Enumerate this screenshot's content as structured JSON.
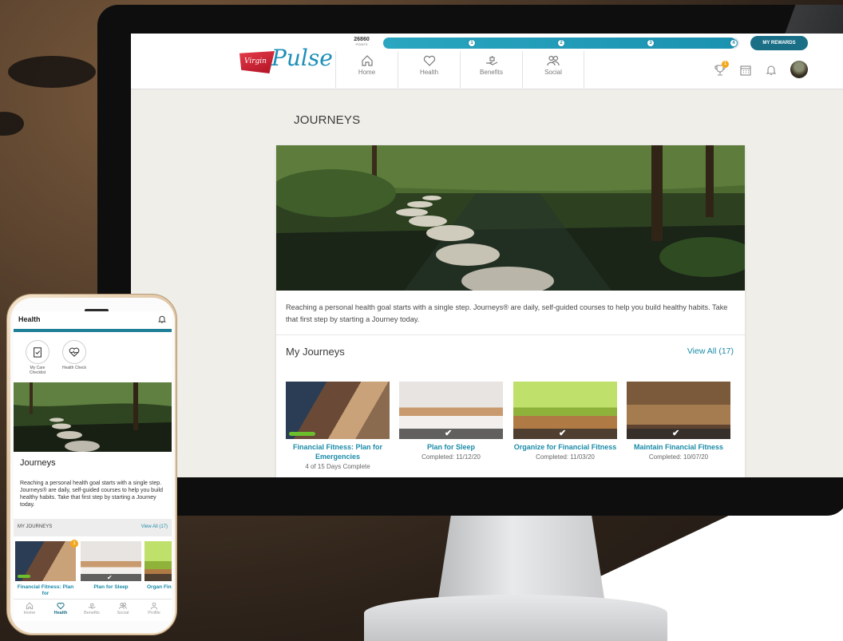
{
  "desktop": {
    "brand": {
      "flag_text": "Virgin",
      "word": "Pulse"
    },
    "points": {
      "value": "26860",
      "label": "POINTS"
    },
    "progress": {
      "fraction": 0.99,
      "milestones": [
        "1",
        "2",
        "3",
        "4"
      ]
    },
    "rewards_button": "MY REWARDS",
    "nav": [
      {
        "label": "Home",
        "icon": "home-icon"
      },
      {
        "label": "Health",
        "icon": "heart-icon"
      },
      {
        "label": "Benefits",
        "icon": "benefits-icon"
      },
      {
        "label": "Social",
        "icon": "people-icon"
      }
    ],
    "trophy_badge": "1",
    "page_title": "JOURNEYS",
    "intro": "Reaching a personal health goal starts with a single step. Journeys® are daily, self-guided courses to help you build healthy habits. Take that first step by starting a Journey today.",
    "section_title": "My Journeys",
    "view_all": "View All (17)",
    "journeys": [
      {
        "title": "Financial Fitness: Plan for Emergencies",
        "status": "4 of 15 Days Complete",
        "progress": 0.27
      },
      {
        "title": "Plan for Sleep",
        "status": "Completed: 11/12/20"
      },
      {
        "title": "Organize for Financial Fitness",
        "status": "Completed: 11/03/20"
      },
      {
        "title": "Maintain Financial Fitness",
        "status": "Completed: 10/07/20"
      }
    ]
  },
  "phone": {
    "header": "Health",
    "quick": [
      {
        "label": "My Care Checklist",
        "icon": "clipboard-check-icon"
      },
      {
        "label": "Health Check",
        "icon": "heart-pulse-icon"
      }
    ],
    "title": "Journeys",
    "intro": "Reaching a personal health goal starts with a single step. Journeys® are daily, self-guided courses to help you build healthy habits. Take that first step by starting a Journey today.",
    "my_journeys": "MY JOURNEYS",
    "view_all": "View All (17)",
    "badge": "1",
    "cards": [
      {
        "title": "Financial Fitness: Plan for"
      },
      {
        "title": "Plan for Sleep"
      },
      {
        "title": "Organ Financi"
      }
    ],
    "nav": [
      {
        "label": "Home",
        "icon": "home-icon"
      },
      {
        "label": "Health",
        "icon": "heart-icon"
      },
      {
        "label": "Benefits",
        "icon": "benefits-icon"
      },
      {
        "label": "Social",
        "icon": "people-icon"
      },
      {
        "label": "Profile",
        "icon": "person-icon"
      }
    ]
  },
  "colors": {
    "accent": "#1a8ba8",
    "brand_dark": "#1a6f87",
    "progress_green": "#6cbf2c",
    "badge": "#f2a81d"
  }
}
